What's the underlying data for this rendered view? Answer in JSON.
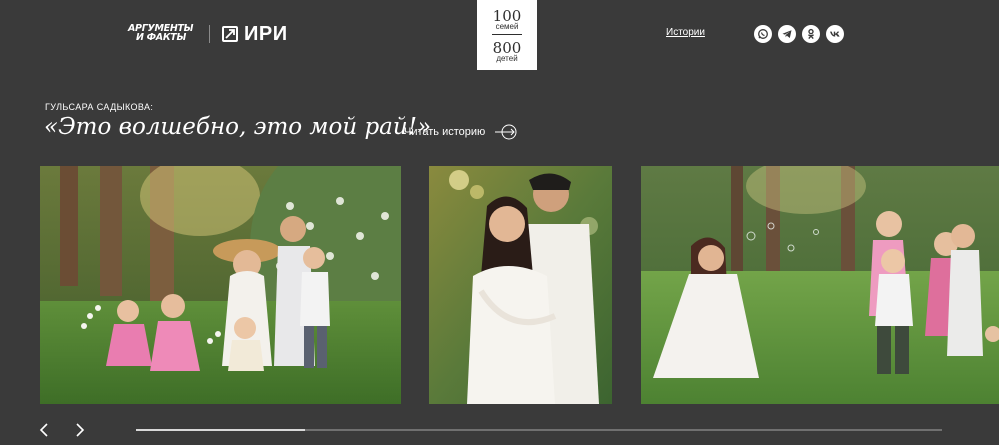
{
  "header": {
    "logo_aif_line1": "АРГУМЕНТЫ",
    "logo_aif_line2": "И ФАКТЫ",
    "logo_iri": "ИРИ",
    "badge": {
      "top_number": "100",
      "top_label": "семей",
      "bottom_number": "800",
      "bottom_label": "детей"
    },
    "nav_stories": "Истории",
    "socials": [
      "whatsapp-icon",
      "telegram-icon",
      "odnoklassniki-icon",
      "vk-icon"
    ]
  },
  "hero": {
    "subtitle": "ГУЛЬСАРА САДЫКОВА:",
    "headline": "«Это волшебно, это мой рай!»",
    "read_link": "Читать историю"
  },
  "gallery": {
    "photos": [
      "family-photo-group",
      "couple-photo",
      "family-playing-photo"
    ],
    "progress": 0.21
  },
  "colors": {
    "background": "#3a3a3a",
    "text": "#ffffff",
    "badge_bg": "#ffffff"
  }
}
